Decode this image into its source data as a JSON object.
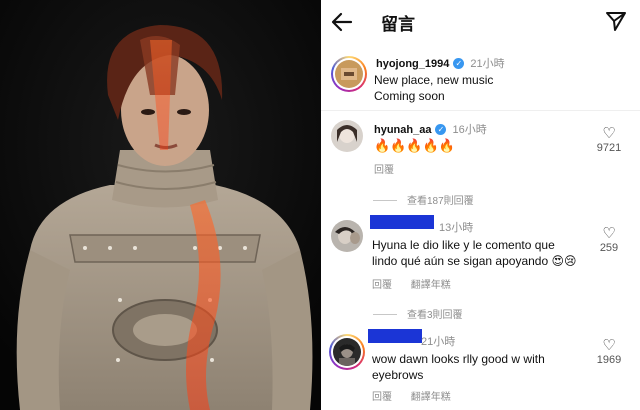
{
  "header": {
    "title": "留言",
    "back_icon": "arrow-left-icon",
    "send_icon": "paper-plane-icon"
  },
  "post": {
    "username": "hyojong_1994",
    "verified": true,
    "time": "21小時",
    "caption_line1": "New place, new music",
    "caption_line2": "Coming soon"
  },
  "comments": [
    {
      "username": "hyunah_aa",
      "verified": true,
      "time": "16小時",
      "text": "🔥🔥🔥🔥🔥",
      "reply_label": "回覆",
      "likes": "9721",
      "view_replies": "查看187則回覆"
    },
    {
      "username": "",
      "time": "13小時",
      "text_line1": "Hyuna le dio like y le comento que",
      "text_line2": "lindo qué aún se sigan apoyando 😍😢",
      "reply_label": "回覆",
      "translate_label": "翻譯年糕",
      "likes": "259",
      "view_replies": "查看3則回覆"
    },
    {
      "username": "",
      "time": "21小時",
      "text_line1": "wow dawn looks rlly good w with",
      "text_line2": "eyebrows",
      "reply_label": "回覆",
      "translate_label": "翻譯年糕",
      "likes": "1969"
    }
  ],
  "colors": {
    "redaction": "#1b35d6",
    "verified": "#3897f0",
    "muted_text": "#8e8e8e"
  }
}
